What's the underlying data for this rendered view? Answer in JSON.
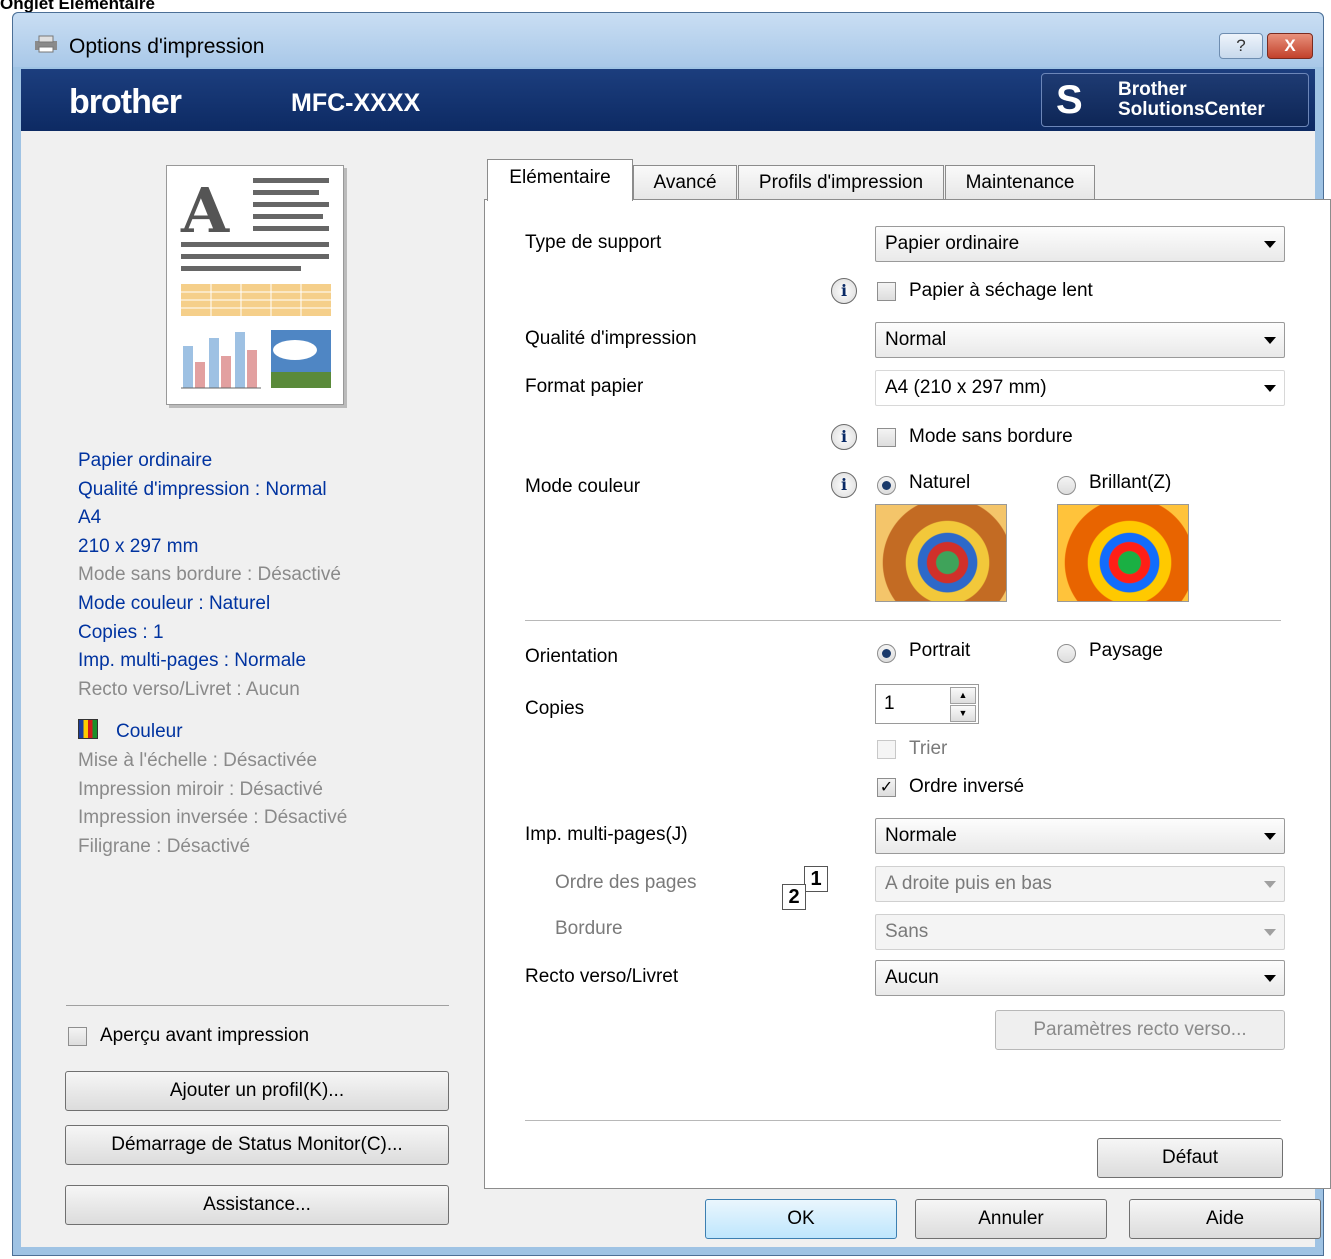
{
  "caption": "Onglet Elémentaire",
  "window": {
    "title": "Options d'impression",
    "help_label": "?",
    "close_label": "X"
  },
  "brand": {
    "logo": "brother",
    "model": "MFC-XXXX",
    "solutions_line1": "Brother",
    "solutions_line2": "SolutionsCenter"
  },
  "summary": {
    "media": "Papier ordinaire",
    "quality": "Qualité d'impression : Normal",
    "paper": "A4",
    "paper_dim": "210 x 297 mm",
    "borderless": "Mode sans bordure : Désactivé",
    "color_mode": "Mode couleur : Naturel",
    "copies": "Copies : 1",
    "multipage": "Imp. multi-pages : Normale",
    "duplex": "Recto verso/Livret : Aucun",
    "color": "Couleur",
    "scaling": "Mise à l'échelle : Désactivée",
    "mirror": "Impression miroir : Désactivé",
    "reverse": "Impression inversée : Désactivé",
    "watermark": "Filigrane : Désactivé"
  },
  "left": {
    "preview_check": "Aperçu avant impression",
    "add_profile": "Ajouter un profil(K)...",
    "status_monitor": "Démarrage de Status Monitor(C)...",
    "support": "Assistance..."
  },
  "tabs": [
    "Elémentaire",
    "Avancé",
    "Profils d'impression",
    "Maintenance"
  ],
  "basic": {
    "media_label": "Type de support",
    "media_value": "Papier ordinaire",
    "slow_dry": "Papier à séchage lent",
    "quality_label": "Qualité d'impression",
    "quality_value": "Normal",
    "paper_label": "Format papier",
    "paper_value": "A4 (210 x 297 mm)",
    "borderless": "Mode sans bordure",
    "color_label": "Mode couleur",
    "natural": "Naturel",
    "vivid": "Brillant(Z)",
    "orientation_label": "Orientation",
    "portrait": "Portrait",
    "landscape": "Paysage",
    "copies_label": "Copies",
    "copies_value": "1",
    "collate": "Trier",
    "reverse": "Ordre inversé",
    "collate_icon_a": "1",
    "collate_icon_b": "2",
    "multipage_label": "Imp. multi-pages(J)",
    "multipage_value": "Normale",
    "order_label": "Ordre des pages",
    "order_value": "A droite puis en bas",
    "border_label": "Bordure",
    "border_value": "Sans",
    "duplex_label": "Recto verso/Livret",
    "duplex_value": "Aucun",
    "duplex_settings": "Paramètres recto verso...",
    "default": "Défaut"
  },
  "footer": {
    "ok": "OK",
    "cancel": "Annuler",
    "help": "Aide"
  }
}
